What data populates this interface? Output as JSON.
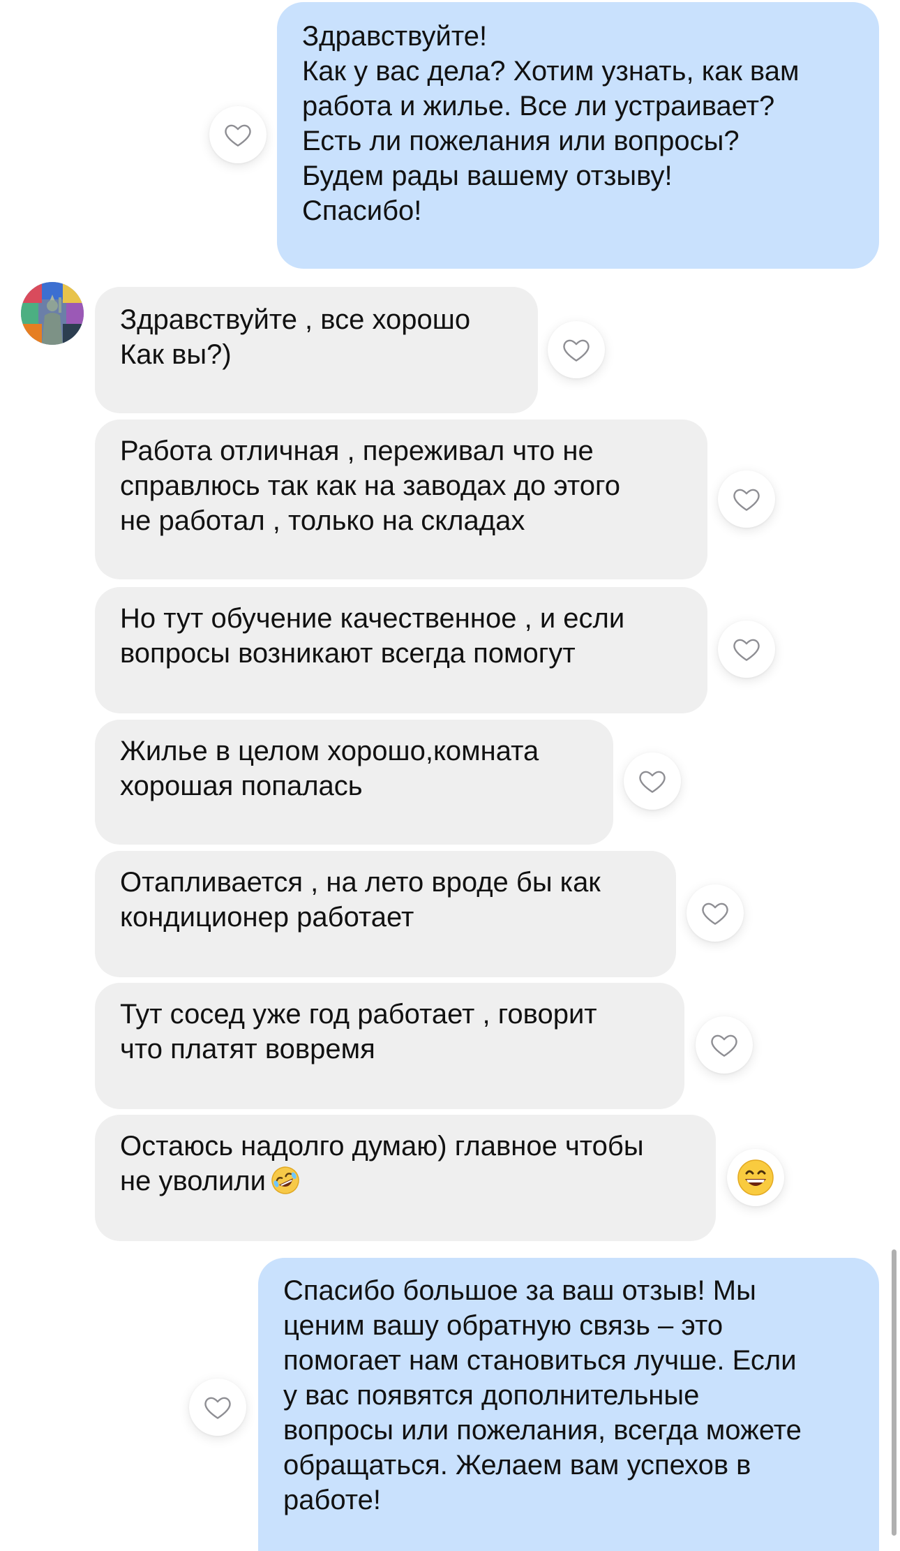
{
  "messages": [
    {
      "direction": "outgoing",
      "lines": [
        "Здравствуйте!",
        "Как у вас дела? Хотим узнать, как вам",
        "работа и жилье. Все ли устраивает?",
        "Есть ли пожелания или вопросы?",
        "Будем рады вашему отзыву!",
        "Спасибо!"
      ],
      "reaction": "heart-outline"
    },
    {
      "direction": "incoming",
      "lines": [
        "Здравствуйте , все хорошо",
        "Как вы?)"
      ],
      "reaction": "heart-outline"
    },
    {
      "direction": "incoming",
      "lines": [
        "Работа отличная , переживал что не",
        "справлюсь так как на заводах до этого",
        "не работал , только на складах"
      ],
      "reaction": "heart-outline"
    },
    {
      "direction": "incoming",
      "lines": [
        "Но тут обучение качественное , и если",
        "вопросы  возникают всегда помогут"
      ],
      "reaction": "heart-outline"
    },
    {
      "direction": "incoming",
      "lines": [
        "Жилье в целом хорошо,комната",
        "хорошая попалась"
      ],
      "reaction": "heart-outline"
    },
    {
      "direction": "incoming",
      "lines": [
        "Отапливается , на лето вроде бы как",
        "кондиционер работает"
      ],
      "reaction": "heart-outline"
    },
    {
      "direction": "incoming",
      "lines": [
        "Тут сосед уже год работает , говорит",
        "что платят вовремя"
      ],
      "reaction": "heart-outline"
    },
    {
      "direction": "incoming",
      "lines": [
        "Остаюсь надолго думаю) главное чтобы",
        "не уволили"
      ],
      "inline_emoji": "rolling-laughing-emoji",
      "reaction": "grinning-face-emoji"
    },
    {
      "direction": "outgoing",
      "lines": [
        "Спасибо большое за ваш отзыв! Мы",
        "ценим вашу обратную связь – это",
        "помогает нам становиться лучше. Если",
        "у вас появятся дополнительные",
        "вопросы или пожелания, всегда можете",
        "обращаться. Желаем вам успехов в",
        "работе!"
      ],
      "reaction": "heart-outline"
    }
  ],
  "colors": {
    "outgoing_bubble": "#c9e1fd",
    "incoming_bubble": "#efefef",
    "text": "#111111",
    "heart_stroke": "#8e8e93"
  }
}
